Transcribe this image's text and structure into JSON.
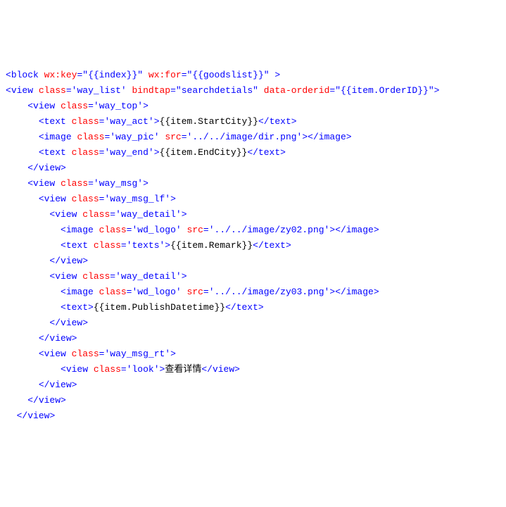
{
  "code": {
    "lines": [
      {
        "indent": 0,
        "segments": [
          {
            "t": "punc",
            "v": "<"
          },
          {
            "t": "tag",
            "v": "block"
          },
          {
            "t": "plain",
            "v": " "
          },
          {
            "t": "attr-name",
            "v": "wx:key"
          },
          {
            "t": "attr-eq",
            "v": "="
          },
          {
            "t": "attr-val",
            "v": "\"{{index}}\""
          },
          {
            "t": "plain",
            "v": " "
          },
          {
            "t": "attr-name",
            "v": "wx:for"
          },
          {
            "t": "attr-eq",
            "v": "="
          },
          {
            "t": "attr-val",
            "v": "\"{{goodslist}}\""
          },
          {
            "t": "plain",
            "v": " "
          },
          {
            "t": "punc",
            "v": ">"
          }
        ]
      },
      {
        "indent": 0,
        "segments": [
          {
            "t": "punc",
            "v": "<"
          },
          {
            "t": "tag",
            "v": "view"
          },
          {
            "t": "plain",
            "v": " "
          },
          {
            "t": "attr-name",
            "v": "class"
          },
          {
            "t": "attr-eq",
            "v": "="
          },
          {
            "t": "attr-val",
            "v": "'way_list'"
          },
          {
            "t": "plain",
            "v": " "
          },
          {
            "t": "attr-name",
            "v": "bindtap"
          },
          {
            "t": "attr-eq",
            "v": "="
          },
          {
            "t": "attr-val",
            "v": "\"searchdetials\""
          },
          {
            "t": "plain",
            "v": " "
          },
          {
            "t": "attr-name",
            "v": "data-orderid"
          },
          {
            "t": "attr-eq",
            "v": "="
          },
          {
            "t": "attr-val",
            "v": "\"{{item.OrderID}}\""
          },
          {
            "t": "punc",
            "v": ">"
          }
        ]
      },
      {
        "indent": 2,
        "segments": [
          {
            "t": "punc",
            "v": "<"
          },
          {
            "t": "tag",
            "v": "view"
          },
          {
            "t": "plain",
            "v": " "
          },
          {
            "t": "attr-name",
            "v": "class"
          },
          {
            "t": "attr-eq",
            "v": "="
          },
          {
            "t": "attr-val",
            "v": "'way_top'"
          },
          {
            "t": "punc",
            "v": ">"
          }
        ]
      },
      {
        "indent": 3,
        "segments": [
          {
            "t": "punc",
            "v": "<"
          },
          {
            "t": "tag",
            "v": "text"
          },
          {
            "t": "plain",
            "v": " "
          },
          {
            "t": "attr-name",
            "v": "class"
          },
          {
            "t": "attr-eq",
            "v": "="
          },
          {
            "t": "attr-val",
            "v": "'way_act'"
          },
          {
            "t": "punc",
            "v": ">"
          },
          {
            "t": "text-content",
            "v": "{{item.StartCity}}"
          },
          {
            "t": "punc",
            "v": "</"
          },
          {
            "t": "tag",
            "v": "text"
          },
          {
            "t": "punc",
            "v": ">"
          }
        ]
      },
      {
        "indent": 3,
        "segments": [
          {
            "t": "punc",
            "v": "<"
          },
          {
            "t": "tag",
            "v": "image"
          },
          {
            "t": "plain",
            "v": " "
          },
          {
            "t": "attr-name",
            "v": "class"
          },
          {
            "t": "attr-eq",
            "v": "="
          },
          {
            "t": "attr-val",
            "v": "'way_pic'"
          },
          {
            "t": "plain",
            "v": " "
          },
          {
            "t": "attr-name",
            "v": "src"
          },
          {
            "t": "attr-eq",
            "v": "="
          },
          {
            "t": "attr-val",
            "v": "'../../image/dir.png'"
          },
          {
            "t": "punc",
            "v": ">"
          },
          {
            "t": "punc",
            "v": "</"
          },
          {
            "t": "tag",
            "v": "image"
          },
          {
            "t": "punc",
            "v": ">"
          }
        ]
      },
      {
        "indent": 3,
        "segments": [
          {
            "t": "punc",
            "v": "<"
          },
          {
            "t": "tag",
            "v": "text"
          },
          {
            "t": "plain",
            "v": " "
          },
          {
            "t": "attr-name",
            "v": "class"
          },
          {
            "t": "attr-eq",
            "v": "="
          },
          {
            "t": "attr-val",
            "v": "'way_end'"
          },
          {
            "t": "punc",
            "v": ">"
          },
          {
            "t": "text-content",
            "v": "{{item.EndCity}}"
          },
          {
            "t": "punc",
            "v": "</"
          },
          {
            "t": "tag",
            "v": "text"
          },
          {
            "t": "punc",
            "v": ">"
          }
        ]
      },
      {
        "indent": 2,
        "segments": [
          {
            "t": "punc",
            "v": "</"
          },
          {
            "t": "tag",
            "v": "view"
          },
          {
            "t": "punc",
            "v": ">"
          }
        ]
      },
      {
        "indent": 2,
        "segments": [
          {
            "t": "punc",
            "v": "<"
          },
          {
            "t": "tag",
            "v": "view"
          },
          {
            "t": "plain",
            "v": " "
          },
          {
            "t": "attr-name",
            "v": "class"
          },
          {
            "t": "attr-eq",
            "v": "="
          },
          {
            "t": "attr-val",
            "v": "'way_msg'"
          },
          {
            "t": "punc",
            "v": ">"
          }
        ]
      },
      {
        "indent": 3,
        "segments": [
          {
            "t": "punc",
            "v": "<"
          },
          {
            "t": "tag",
            "v": "view"
          },
          {
            "t": "plain",
            "v": " "
          },
          {
            "t": "attr-name",
            "v": "class"
          },
          {
            "t": "attr-eq",
            "v": "="
          },
          {
            "t": "attr-val",
            "v": "'way_msg_lf'"
          },
          {
            "t": "punc",
            "v": ">"
          }
        ]
      },
      {
        "indent": 4,
        "segments": [
          {
            "t": "punc",
            "v": "<"
          },
          {
            "t": "tag",
            "v": "view"
          },
          {
            "t": "plain",
            "v": " "
          },
          {
            "t": "attr-name",
            "v": "class"
          },
          {
            "t": "attr-eq",
            "v": "="
          },
          {
            "t": "attr-val",
            "v": "'way_detail'"
          },
          {
            "t": "punc",
            "v": ">"
          }
        ]
      },
      {
        "indent": 5,
        "segments": [
          {
            "t": "punc",
            "v": "<"
          },
          {
            "t": "tag",
            "v": "image"
          },
          {
            "t": "plain",
            "v": " "
          },
          {
            "t": "attr-name",
            "v": "class"
          },
          {
            "t": "attr-eq",
            "v": "="
          },
          {
            "t": "attr-val",
            "v": "'wd_logo'"
          },
          {
            "t": "plain",
            "v": " "
          },
          {
            "t": "attr-name",
            "v": "src"
          },
          {
            "t": "attr-eq",
            "v": "="
          },
          {
            "t": "attr-val",
            "v": "'../../image/zy02.png'"
          },
          {
            "t": "punc",
            "v": ">"
          },
          {
            "t": "punc",
            "v": "</"
          },
          {
            "t": "tag",
            "v": "image"
          },
          {
            "t": "punc",
            "v": ">"
          }
        ]
      },
      {
        "indent": 5,
        "segments": [
          {
            "t": "punc",
            "v": "<"
          },
          {
            "t": "tag",
            "v": "text"
          },
          {
            "t": "plain",
            "v": " "
          },
          {
            "t": "attr-name",
            "v": "class"
          },
          {
            "t": "attr-eq",
            "v": "="
          },
          {
            "t": "attr-val",
            "v": "'texts'"
          },
          {
            "t": "punc",
            "v": ">"
          },
          {
            "t": "text-content",
            "v": "{{item.Remark}}"
          },
          {
            "t": "punc",
            "v": "</"
          },
          {
            "t": "tag",
            "v": "text"
          },
          {
            "t": "punc",
            "v": ">"
          }
        ]
      },
      {
        "indent": 4,
        "segments": [
          {
            "t": "punc",
            "v": "</"
          },
          {
            "t": "tag",
            "v": "view"
          },
          {
            "t": "punc",
            "v": ">"
          }
        ]
      },
      {
        "indent": 4,
        "segments": [
          {
            "t": "punc",
            "v": "<"
          },
          {
            "t": "tag",
            "v": "view"
          },
          {
            "t": "plain",
            "v": " "
          },
          {
            "t": "attr-name",
            "v": "class"
          },
          {
            "t": "attr-eq",
            "v": "="
          },
          {
            "t": "attr-val",
            "v": "'way_detail'"
          },
          {
            "t": "punc",
            "v": ">"
          }
        ]
      },
      {
        "indent": 5,
        "segments": [
          {
            "t": "punc",
            "v": "<"
          },
          {
            "t": "tag",
            "v": "image"
          },
          {
            "t": "plain",
            "v": " "
          },
          {
            "t": "attr-name",
            "v": "class"
          },
          {
            "t": "attr-eq",
            "v": "="
          },
          {
            "t": "attr-val",
            "v": "'wd_logo'"
          },
          {
            "t": "plain",
            "v": " "
          },
          {
            "t": "attr-name",
            "v": "src"
          },
          {
            "t": "attr-eq",
            "v": "="
          },
          {
            "t": "attr-val",
            "v": "'../../image/zy03.png'"
          },
          {
            "t": "punc",
            "v": ">"
          },
          {
            "t": "punc",
            "v": "</"
          },
          {
            "t": "tag",
            "v": "image"
          },
          {
            "t": "punc",
            "v": ">"
          }
        ]
      },
      {
        "indent": 5,
        "segments": [
          {
            "t": "punc",
            "v": "<"
          },
          {
            "t": "tag",
            "v": "text"
          },
          {
            "t": "punc",
            "v": ">"
          },
          {
            "t": "text-content",
            "v": "{{item.PublishDatetime}}"
          },
          {
            "t": "punc",
            "v": "</"
          },
          {
            "t": "tag",
            "v": "text"
          },
          {
            "t": "punc",
            "v": ">"
          }
        ]
      },
      {
        "indent": 4,
        "segments": [
          {
            "t": "punc",
            "v": "</"
          },
          {
            "t": "tag",
            "v": "view"
          },
          {
            "t": "punc",
            "v": ">"
          }
        ]
      },
      {
        "indent": 3,
        "segments": [
          {
            "t": "punc",
            "v": "</"
          },
          {
            "t": "tag",
            "v": "view"
          },
          {
            "t": "punc",
            "v": ">"
          }
        ]
      },
      {
        "indent": 3,
        "segments": [
          {
            "t": "punc",
            "v": "<"
          },
          {
            "t": "tag",
            "v": "view"
          },
          {
            "t": "plain",
            "v": " "
          },
          {
            "t": "attr-name",
            "v": "class"
          },
          {
            "t": "attr-eq",
            "v": "="
          },
          {
            "t": "attr-val",
            "v": "'way_msg_rt'"
          },
          {
            "t": "punc",
            "v": ">"
          }
        ]
      },
      {
        "indent": 5,
        "segments": [
          {
            "t": "punc",
            "v": "<"
          },
          {
            "t": "tag",
            "v": "view"
          },
          {
            "t": "plain",
            "v": " "
          },
          {
            "t": "attr-name",
            "v": "class"
          },
          {
            "t": "attr-eq",
            "v": "="
          },
          {
            "t": "attr-val",
            "v": "'look'"
          },
          {
            "t": "punc",
            "v": ">"
          },
          {
            "t": "text-content",
            "v": "查看详情"
          },
          {
            "t": "punc",
            "v": "</"
          },
          {
            "t": "tag",
            "v": "view"
          },
          {
            "t": "punc",
            "v": ">"
          }
        ]
      },
      {
        "indent": 3,
        "segments": [
          {
            "t": "punc",
            "v": "</"
          },
          {
            "t": "tag",
            "v": "view"
          },
          {
            "t": "punc",
            "v": ">"
          }
        ]
      },
      {
        "indent": 2,
        "segments": [
          {
            "t": "punc",
            "v": "</"
          },
          {
            "t": "tag",
            "v": "view"
          },
          {
            "t": "punc",
            "v": ">"
          }
        ]
      },
      {
        "indent": 1,
        "segments": [
          {
            "t": "punc",
            "v": "</"
          },
          {
            "t": "tag",
            "v": "view"
          },
          {
            "t": "punc",
            "v": ">"
          }
        ]
      }
    ],
    "indent_unit": "  "
  }
}
